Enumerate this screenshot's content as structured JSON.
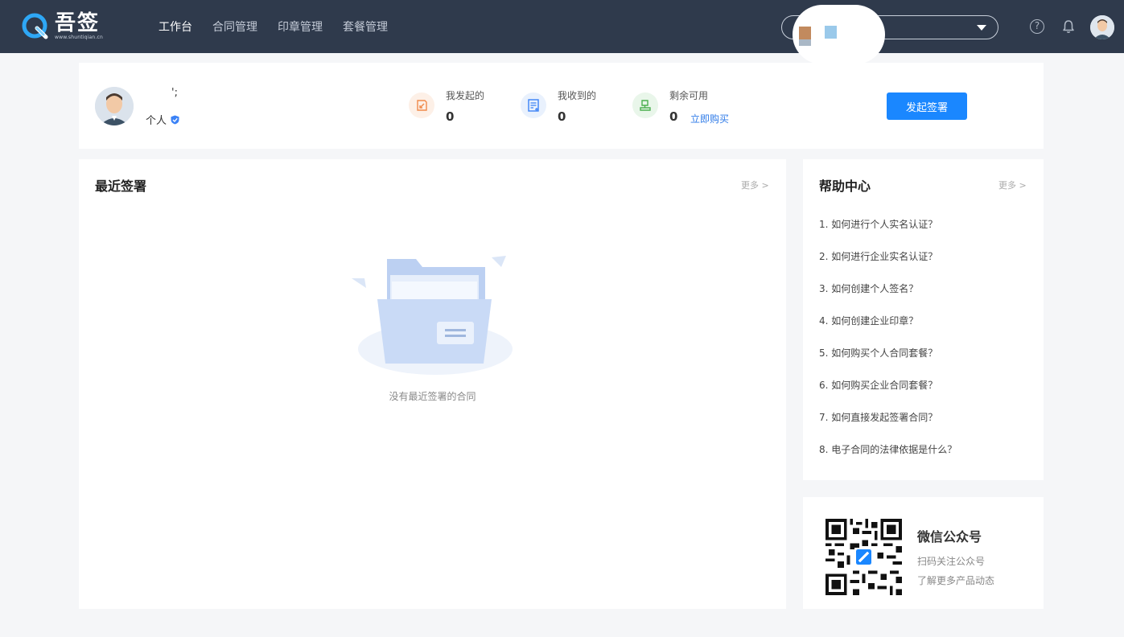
{
  "brand": {
    "name": "吾签",
    "url": "www.shuntiqian.cn",
    "accent": "#1a87ff",
    "nav_bg": "#2f3a4c"
  },
  "nav": {
    "items": [
      {
        "label": "工作台",
        "active": true
      },
      {
        "label": "合同管理",
        "active": false
      },
      {
        "label": "印章管理",
        "active": false
      },
      {
        "label": "套餐管理",
        "active": false
      }
    ]
  },
  "header_icons": {
    "help": "?",
    "help_icon": "question-circle-icon",
    "bell_icon": "bell-icon",
    "avatar_icon": "avatar"
  },
  "profile": {
    "name": "';",
    "type": "个人",
    "verified_icon": "shield-check-icon"
  },
  "stats": [
    {
      "label": "我发起的",
      "value": "0",
      "icon": "sign-icon",
      "color": "#f08a4b"
    },
    {
      "label": "我收到的",
      "value": "0",
      "icon": "document-icon",
      "color": "#3b82f6"
    },
    {
      "label": "剩余可用",
      "value": "0",
      "icon": "stamp-icon",
      "color": "#4caf50",
      "link": "立即购买"
    }
  ],
  "actions": {
    "start_sign": "发起签署"
  },
  "recent": {
    "title": "最近签署",
    "more": "更多 >",
    "empty": "没有最近签署的合同"
  },
  "help": {
    "title": "帮助中心",
    "more": "更多 >",
    "items": [
      "1. 如何进行个人实名认证？",
      "2. 如何进行企业实名认证？",
      "3. 如何创建个人签名？",
      "4. 如何创建企业印章？",
      "5. 如何购买个人合同套餐？",
      "6. 如何购买企业合同套餐？",
      "7. 如何直接发起签署合同？",
      "8. 电子合同的法律依据是什么？"
    ]
  },
  "wechat": {
    "title": "微信公众号",
    "sub1": "扫码关注公众号",
    "sub2": "了解更多产品动态"
  }
}
